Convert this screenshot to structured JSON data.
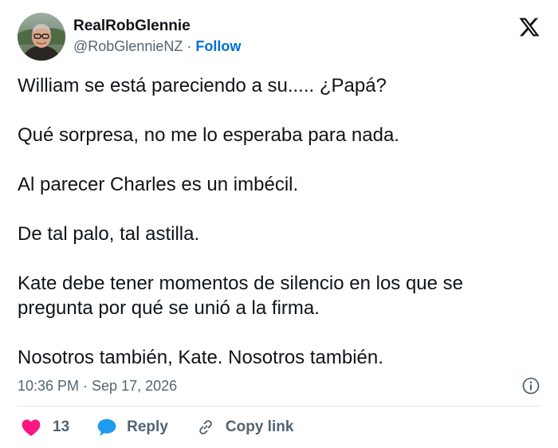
{
  "author": {
    "display_name": "RealRobGlennie",
    "handle": "@RobGlennieNZ",
    "separator": "·",
    "follow_label": "Follow"
  },
  "tweet": {
    "paragraphs": [
      "William se está pareciendo a su..... ¿Papá?",
      "Qué sorpresa, no me lo esperaba para nada.",
      "Al parecer Charles es un imbécil.",
      "De tal palo, tal astilla.",
      "Kate debe tener momentos de silencio en los que se pregunta por qué se unió a la firma.",
      "Nosotros también, Kate. Nosotros también."
    ],
    "timestamp": "10:36 PM · Sep 17, 2026"
  },
  "actions": {
    "like_count": "13",
    "reply_label": "Reply",
    "copy_link_label": "Copy link"
  },
  "colors": {
    "like_heart": "#f91880",
    "reply_bubble": "#1d9bf0",
    "follow_link": "#006fd6",
    "secondary_text": "#536471"
  },
  "icons": {
    "brand": "x-logo-icon",
    "info": "info-icon",
    "like": "heart-icon",
    "reply": "speech-bubble-icon",
    "copy": "link-icon"
  }
}
